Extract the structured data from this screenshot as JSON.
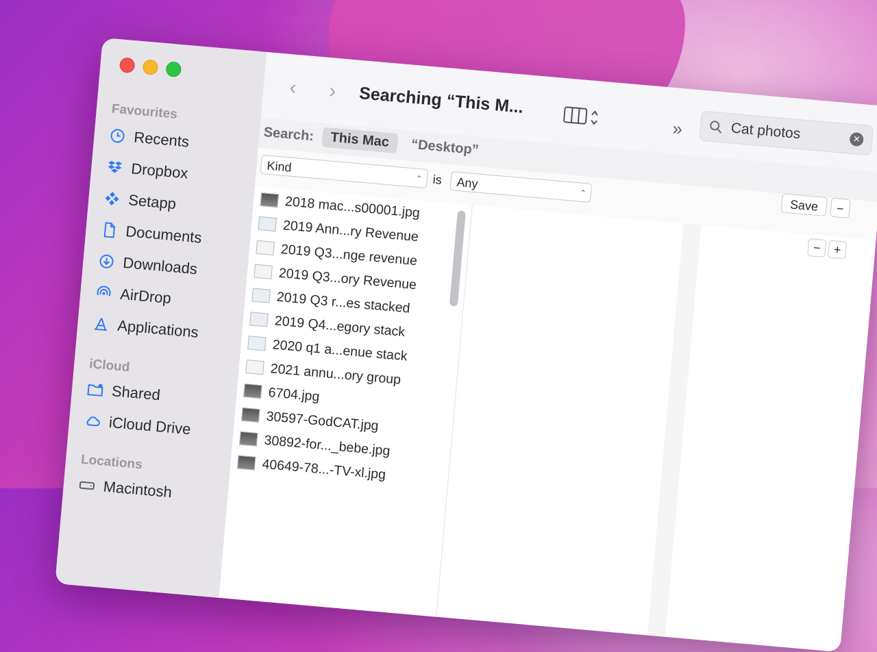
{
  "window": {
    "title": "Searching “This M...",
    "nav_back": "‹",
    "nav_forward": "›"
  },
  "sidebar": {
    "favourites_label": "Favourites",
    "favourites": [
      {
        "label": "Recents",
        "icon": "clock-icon"
      },
      {
        "label": "Dropbox",
        "icon": "dropbox-icon"
      },
      {
        "label": "Setapp",
        "icon": "setapp-icon"
      },
      {
        "label": "Documents",
        "icon": "document-icon"
      },
      {
        "label": "Downloads",
        "icon": "download-icon"
      },
      {
        "label": "AirDrop",
        "icon": "airdrop-icon"
      },
      {
        "label": "Applications",
        "icon": "applications-icon"
      }
    ],
    "icloud_label": "iCloud",
    "icloud": [
      {
        "label": "Shared",
        "icon": "shared-folder-icon"
      },
      {
        "label": "iCloud Drive",
        "icon": "cloud-icon"
      }
    ],
    "locations_label": "Locations",
    "locations": [
      {
        "label": "Macintosh",
        "icon": "disk-icon"
      }
    ]
  },
  "toolbar": {
    "more": "»",
    "search_value": "Cat photos"
  },
  "scope": {
    "label": "Search:",
    "this_mac": "This Mac",
    "desktop": "“Desktop”"
  },
  "criteria": {
    "attribute": "Kind",
    "is_label": "is",
    "value": "Any",
    "save": "Save",
    "minus": "−",
    "plus": "+"
  },
  "files": [
    {
      "name": "2018 mac...s00001.jpg",
      "thumb": "photo"
    },
    {
      "name": "2019 Ann...ry Revenue",
      "thumb": "chart"
    },
    {
      "name": "2019 Q3...nge revenue",
      "thumb": "doc"
    },
    {
      "name": "2019 Q3...ory Revenue",
      "thumb": "doc"
    },
    {
      "name": "2019 Q3 r...es stacked",
      "thumb": "chart"
    },
    {
      "name": "2019 Q4...egory stack",
      "thumb": "chart"
    },
    {
      "name": "2020 q1 a...enue stack",
      "thumb": "chart"
    },
    {
      "name": "2021 annu...ory group",
      "thumb": "doc"
    },
    {
      "name": "6704.jpg",
      "thumb": "photo"
    },
    {
      "name": "30597-GodCAT.jpg",
      "thumb": "photo"
    },
    {
      "name": "30892-for..._bebe.jpg",
      "thumb": "photo"
    },
    {
      "name": "40649-78...-TV-xl.jpg",
      "thumb": "photo"
    }
  ],
  "colors": {
    "accent_red": "#f2544f",
    "accent_yellow": "#f8b72c",
    "accent_green": "#2ec640",
    "sidebar_icon": "#2f7bf5"
  }
}
